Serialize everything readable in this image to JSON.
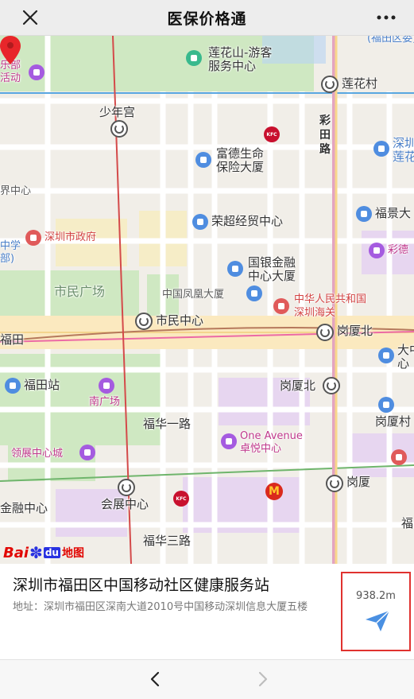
{
  "header": {
    "title": "医保价格通"
  },
  "map": {
    "labels": {
      "lianhuashan": "莲花山-游客服务中心",
      "lianhuashan_line1": "莲花山-游客",
      "lianhuashan_line2": "服务中心",
      "lianhuacun": "莲花村",
      "shaoniangong": "少年宫",
      "caitian_1": "彩",
      "caitian_2": "田",
      "caitian_3": "路",
      "shenzhen_lianhua_1": "深圳",
      "shenzhen_lianhua_2": "莲花",
      "fude_1": "富德生命",
      "fude_2": "保险大厦",
      "jie_zhongxin": "界中心",
      "rongchao": "荣超经贸中心",
      "fujing": "福景大",
      "szgov": "深圳市政府",
      "zhongxue_1": "中学",
      "zhongxue_2": "部)",
      "caide": "彩德",
      "guoyin_1": "国银金融",
      "guoyin_2": "中心大厦",
      "shimin_guangchang": "市民广场",
      "zhongguo_feng": "中国凤凰大厦",
      "customs_1": "中华人民共和国",
      "customs_2": "深圳海关",
      "shimin_zhongxin": "市民中心",
      "gangxia_bei_top": "岗厦北",
      "futian_left": "福田",
      "futian_station": "福田站",
      "dazhong_1": "大中",
      "dazhong_2": "心",
      "gangxia_bei": "岗厦北",
      "nanguangchang": "南广场",
      "gangxia_cun": "岗厦村",
      "fuhua_1": "福华一路",
      "one_avenue_1": "One Avenue",
      "one_avenue_2": "卓悦中心",
      "lingzhan": "领展中心城",
      "gangxia": "岗厦",
      "jinrong_zhongxin": "金融中心",
      "huizhan_zhongxin": "会展中心",
      "fuhua_3": "福华三路",
      "fu": "福",
      "lebu_1": "乐部",
      "lebu_2": "活动",
      "bracket_top": "(福田区委)"
    },
    "kfc": "KFC",
    "mcd": "M",
    "brand": {
      "bai": "Bai",
      "paw": "✽",
      "du": "du",
      "map": "地图"
    }
  },
  "place": {
    "name": "深圳市福田区中国移动社区健康服务站",
    "address": "地址：深圳市福田区深南大道2010号中国移动深圳信息大厦五楼",
    "distance": "938.2m"
  },
  "colors": {
    "header_bg": "#ededed",
    "highlight_border": "#e0322f",
    "nav_icon": "#4a90e2",
    "map_bg": "#f2efe9",
    "park": "#cfe8c2",
    "water": "#b7d4f3"
  },
  "icons": {
    "close": "close-icon",
    "more": "more-icon",
    "navigate": "paper-plane-icon",
    "back": "chevron-left-icon",
    "forward": "chevron-right-icon"
  }
}
